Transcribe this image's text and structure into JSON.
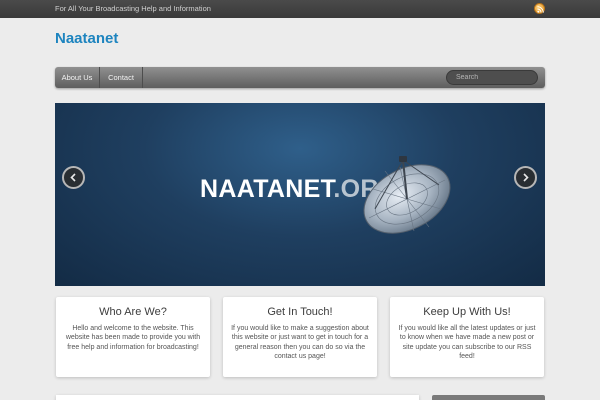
{
  "topbar": {
    "tagline": "For All Your Broadcasting Help and Information",
    "rss_icon": "rss-icon"
  },
  "header": {
    "site_title": "Naatanet"
  },
  "nav": {
    "items": [
      {
        "label": "About Us"
      },
      {
        "label": "Contact"
      }
    ],
    "search_placeholder": "Search"
  },
  "slider": {
    "title_main": "NAATANET",
    "title_suffix": ".ORG",
    "prev_icon": "chevron-left-icon",
    "next_icon": "chevron-right-icon"
  },
  "boxes": [
    {
      "title": "Who Are We?",
      "text": "Hello and welcome to the website. This website has been made to provide you with free help and information for broadcasting!"
    },
    {
      "title": "Get In Touch!",
      "text": "If you would like to make a suggestion about this website or just want to get in touch for a general reason then you can do so via the contact us page!"
    },
    {
      "title": "Keep Up With Us!",
      "text": "If you would like all the latest updates or just to know when we have made a new post or site update you can subscribe to our RSS feed!"
    }
  ],
  "colors": {
    "title_blue": "#1d84bf",
    "topbar_bg": "#3a3a3a",
    "slider_bg": "#1f3f60",
    "rss_orange": "#e0901c"
  }
}
